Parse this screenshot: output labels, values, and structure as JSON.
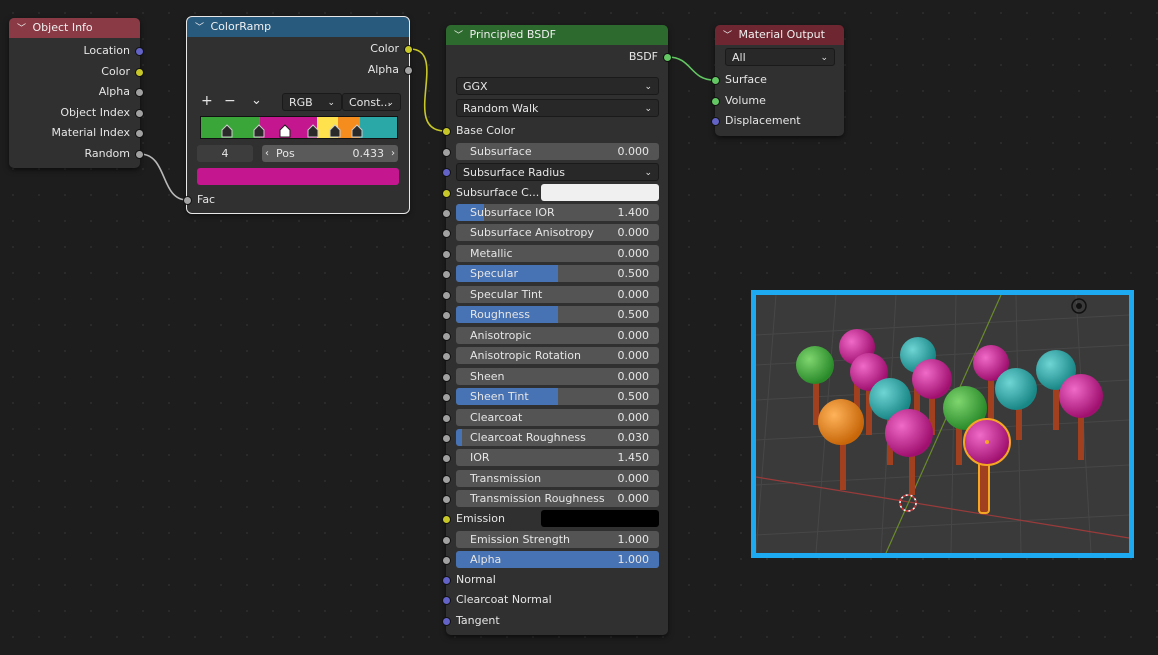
{
  "object_info": {
    "title": "Object Info",
    "outputs": [
      "Location",
      "Color",
      "Alpha",
      "Object Index",
      "Material Index",
      "Random"
    ]
  },
  "color_ramp": {
    "title": "ColorRamp",
    "outputs": [
      "Color",
      "Alpha"
    ],
    "add": "+",
    "remove": "−",
    "menu": "⌄",
    "color_mode": "RGB",
    "interpolation": "Const...",
    "stop_index": "4",
    "pos_label": "Pos",
    "pos_value": "0.433",
    "active_color": "#c4168f",
    "stop_colors": [
      "#3aa63a",
      "#c4168f",
      "#ffe14d",
      "#f58d1e",
      "#2aa7a7"
    ],
    "input": "Fac"
  },
  "bsdf": {
    "title": "Principled BSDF",
    "output": "BSDF",
    "distribution": "GGX",
    "subsurface_method": "Random Walk",
    "base_color": "Base Color",
    "subsurface_radius": "Subsurface Radius",
    "subsurface_color": "Subsurface C...",
    "subsurface_color_value": "#f0f0f0",
    "emission": "Emission",
    "emission_color_value": "#000000",
    "fields": [
      {
        "name": "Subsurface",
        "value": "0.000",
        "fill": 0
      },
      {
        "name": "Subsurface IOR",
        "value": "1.400",
        "fill": 0.14
      },
      {
        "name": "Subsurface Anisotropy",
        "value": "0.000",
        "fill": 0
      },
      {
        "name": "Metallic",
        "value": "0.000",
        "fill": 0
      },
      {
        "name": "Specular",
        "value": "0.500",
        "fill": 0.5
      },
      {
        "name": "Specular Tint",
        "value": "0.000",
        "fill": 0
      },
      {
        "name": "Roughness",
        "value": "0.500",
        "fill": 0.5
      },
      {
        "name": "Anisotropic",
        "value": "0.000",
        "fill": 0
      },
      {
        "name": "Anisotropic Rotation",
        "value": "0.000",
        "fill": 0
      },
      {
        "name": "Sheen",
        "value": "0.000",
        "fill": 0
      },
      {
        "name": "Sheen Tint",
        "value": "0.500",
        "fill": 0.5
      },
      {
        "name": "Clearcoat",
        "value": "0.000",
        "fill": 0
      },
      {
        "name": "Clearcoat Roughness",
        "value": "0.030",
        "fill": 0.03
      },
      {
        "name": "IOR",
        "value": "1.450",
        "fill": 0
      },
      {
        "name": "Transmission",
        "value": "0.000",
        "fill": 0
      },
      {
        "name": "Transmission Roughness",
        "value": "0.000",
        "fill": 0
      },
      {
        "name": "Emission Strength",
        "value": "1.000",
        "fill": 0
      },
      {
        "name": "Alpha",
        "value": "1.000",
        "fill": 1
      }
    ],
    "bottom_inputs": [
      "Normal",
      "Clearcoat Normal",
      "Tangent"
    ]
  },
  "material_output": {
    "title": "Material Output",
    "target": "All",
    "inputs": [
      "Surface",
      "Volume",
      "Displacement"
    ]
  },
  "colors": {
    "viewport_border": "#1eaaf0",
    "header_object_info": "#8a3a45",
    "header_color_ramp": "#285a7e",
    "header_bsdf": "#2d6a2d",
    "header_output": "#6e2630"
  }
}
